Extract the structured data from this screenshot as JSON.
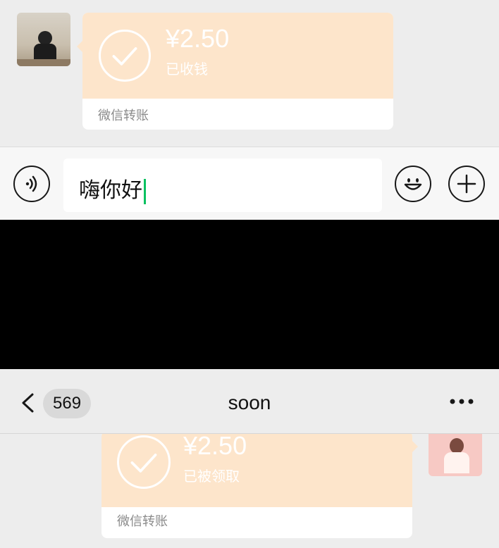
{
  "top_chat": {
    "transfer": {
      "amount": "¥2.50",
      "status": "已收钱",
      "footer": "微信转账"
    }
  },
  "input_bar": {
    "text_value": "嗨你好"
  },
  "nav": {
    "unread_count": "569",
    "title": "soon"
  },
  "bottom_chat": {
    "transfer": {
      "amount": "¥2.50",
      "status": "已被领取",
      "footer": "微信转账"
    }
  },
  "colors": {
    "transfer_orange": "#fde5cb",
    "cursor_green": "#07c160",
    "chat_background": "#ededed"
  },
  "icons": [
    "voice-icon",
    "emoji-icon",
    "plus-icon",
    "back-chevron-icon",
    "more-icon",
    "checkmark-icon"
  ]
}
